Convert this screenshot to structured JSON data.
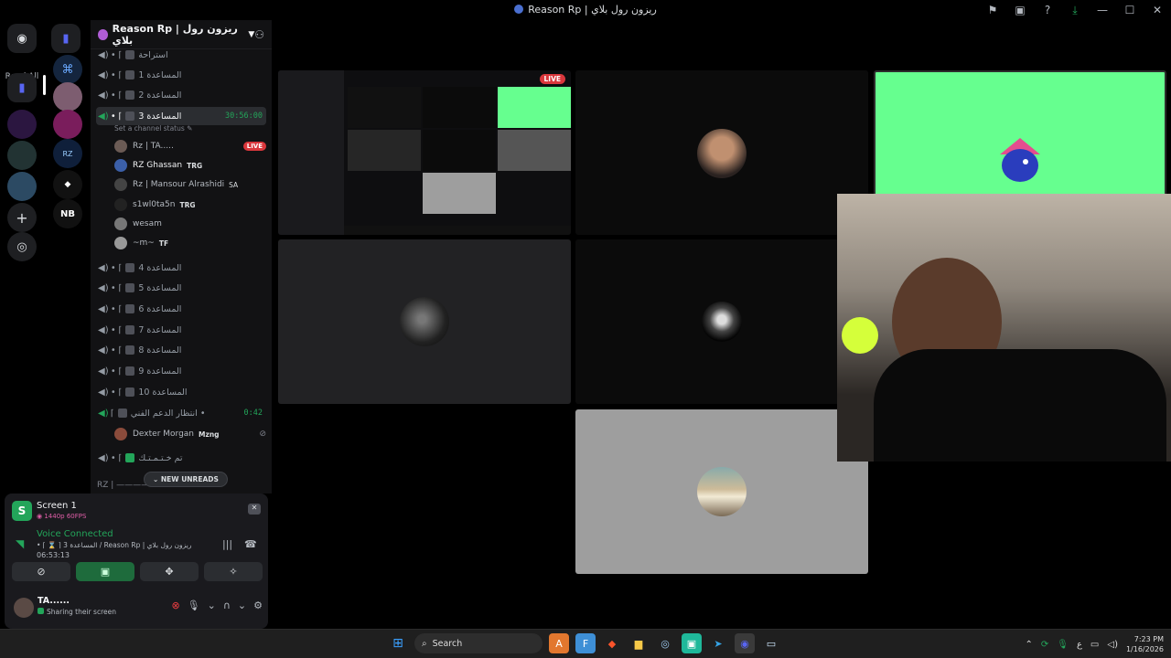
{
  "window": {
    "title": "Reason Rp | ريزون رول بلاي"
  },
  "server_rail": {
    "read_all_label": "Read All"
  },
  "server": {
    "name": "Reason Rp | ريزون رول بلاي"
  },
  "channels": [
    {
      "name": "استراحة",
      "prefix": "• ⌈"
    },
    {
      "name": "المساعدة 1",
      "prefix": "• ⌈"
    },
    {
      "name": "المساعدة 2",
      "prefix": "• ⌈"
    },
    {
      "name": "المساعدة 3",
      "prefix": "• ⌈",
      "timer": "30:56:00",
      "status": "Set a channel status"
    },
    {
      "name": "المساعدة 4",
      "prefix": "• ⌈"
    },
    {
      "name": "المساعدة 5",
      "prefix": "• ⌈"
    },
    {
      "name": "المساعدة 6",
      "prefix": "• ⌈"
    },
    {
      "name": "المساعدة 7",
      "prefix": "• ⌈"
    },
    {
      "name": "المساعدة 8",
      "prefix": "• ⌈"
    },
    {
      "name": "المساعدة 9",
      "prefix": "• ⌈"
    },
    {
      "name": "المساعدة 10",
      "prefix": "• ⌈"
    },
    {
      "name": "انتظار الدعم الفني •",
      "prefix": "⌈",
      "timer": "0:42"
    },
    {
      "name": "تم خـتـمـتـك",
      "prefix": "• ⌈"
    }
  ],
  "channel3_members": [
    {
      "name": "Rz | TA.....",
      "live": "LIVE"
    },
    {
      "name": "RZ Ghassan",
      "tag": "TRG"
    },
    {
      "name": "Rz | Mansour Alrashidi",
      "tag": "SA"
    },
    {
      "name": "s1wl0ta5n",
      "tag": "TRG"
    },
    {
      "name": "wesam"
    },
    {
      "name": "~m~",
      "tag": "TF"
    }
  ],
  "support_members": [
    {
      "name": "Dexter Morgan",
      "tag": "Mzng"
    }
  ],
  "new_unreads_label": "NEW UNREADS",
  "rz_partial": "RZ | ————",
  "stream": {
    "title": "Screen 1",
    "quality": "1440p 60FPS"
  },
  "voice": {
    "status": "Voice Connected",
    "path": "• ⌈ ⌛ ⌉ المساعدة 3 / Reason Rp | ريزون رول بلاي",
    "elapsed": "06:53:13"
  },
  "user": {
    "name": "TA......",
    "status": "Sharing their screen"
  },
  "grid": {
    "live_label": "LIVE"
  },
  "taskbar": {
    "search_placeholder": "Search",
    "time": "7:23 PM",
    "date": "1/16/2026",
    "lang": "ع"
  },
  "colors": {
    "accent_green": "#23a55a",
    "live_red": "#da373c",
    "bright_tile": "#66ff8f",
    "grey_tile": "#9e9e9e"
  }
}
